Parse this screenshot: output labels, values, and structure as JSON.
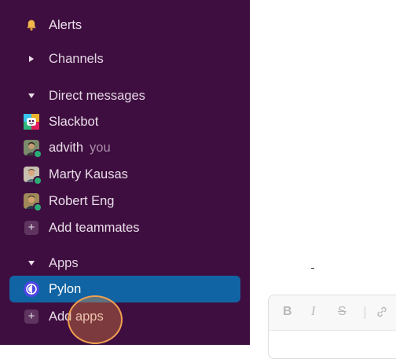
{
  "sidebar": {
    "alerts": {
      "label": "Alerts",
      "icon": "bell-icon"
    },
    "channels": {
      "label": "Channels",
      "icon": "caret-right-icon"
    },
    "direct_messages": {
      "label": "Direct messages",
      "icon": "caret-down-icon",
      "items": [
        {
          "name": "Slackbot",
          "icon": "slackbot-avatar"
        },
        {
          "name": "advith",
          "suffix": "you",
          "icon": "user-avatar",
          "status": "online"
        },
        {
          "name": "Marty Kausas",
          "icon": "user-avatar",
          "status": "online"
        },
        {
          "name": "Robert Eng",
          "icon": "user-avatar",
          "status": "online"
        }
      ],
      "add_label": "Add teammates"
    },
    "apps": {
      "label": "Apps",
      "icon": "caret-down-icon",
      "items": [
        {
          "name": "Pylon",
          "icon": "pylon-app-icon",
          "selected": true
        }
      ],
      "add_label": "Add apps"
    }
  },
  "composer": {
    "toolbar": {
      "bold": "B",
      "italic": "I",
      "strike": "S"
    }
  },
  "colors": {
    "sidebar_bg": "#3f0e40",
    "selected_bg": "#1164a3",
    "presence_online": "#2bac76"
  }
}
